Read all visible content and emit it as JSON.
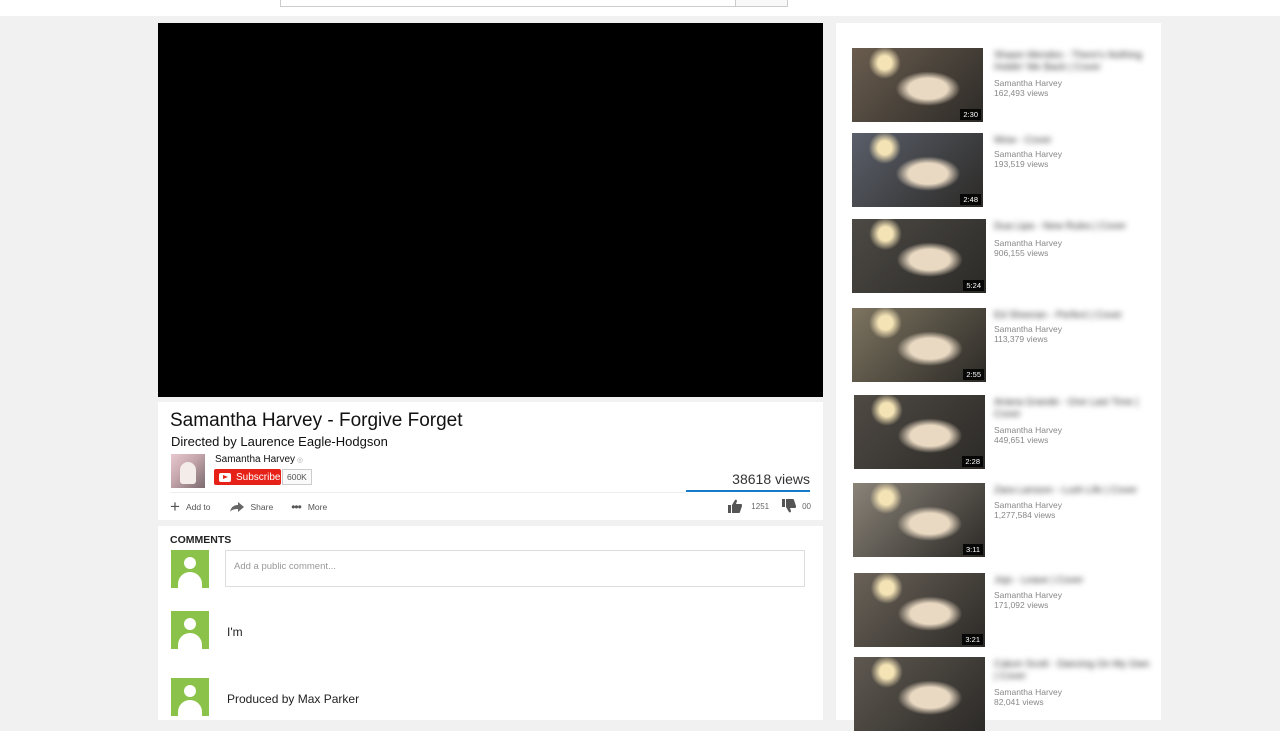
{
  "video": {
    "title": "Samantha Harvey - Forgive Forget",
    "subtitle": "Directed by Laurence Eagle-Hodgson",
    "channel": "Samantha Harvey",
    "subscribe_label": "Subscribe",
    "subscriber_count": "600K",
    "views": "38618 views",
    "like_ratio": 1.0,
    "likes": "1251",
    "dislikes": "00"
  },
  "actions": {
    "add_to": "Add to",
    "share": "Share",
    "more": "More"
  },
  "comments": {
    "heading": "COMMENTS",
    "placeholder": "Add a public comment...",
    "items": [
      {
        "text": "I'm"
      },
      {
        "text": "Produced by Max Parker"
      }
    ]
  },
  "recommendations": [
    {
      "title": "Shawn Mendes - There's Nothing Holdin' Me Back | Cover",
      "channel": "Samantha Harvey",
      "views": "162,493 views",
      "duration": "2:30",
      "thumb_color": "#6a5d4f"
    },
    {
      "title": "Wow - Cover",
      "channel": "Samantha Harvey",
      "views": "193,519 views",
      "duration": "2:48",
      "thumb_color": "#5a5f6a"
    },
    {
      "title": "Dua Lipa - New Rules | Cover",
      "channel": "Samantha Harvey",
      "views": "906,155 views",
      "duration": "5:24",
      "thumb_color": "#4d4a45"
    },
    {
      "title": "Ed Sheeran - Perfect | Cover",
      "channel": "Samantha Harvey",
      "views": "113,379 views",
      "duration": "2:55",
      "thumb_color": "#7d7460"
    },
    {
      "title": "Ariana Grande - One Last Time | Cover",
      "channel": "Samantha Harvey",
      "views": "449,651 views",
      "duration": "2:28",
      "thumb_color": "#4f4a44"
    },
    {
      "title": "Zara Larsson - Lush Life | Cover",
      "channel": "Samantha Harvey",
      "views": "1,277,584 views",
      "duration": "3:11",
      "thumb_color": "#8a8378"
    },
    {
      "title": "Jojo - Leave | Cover",
      "channel": "Samantha Harvey",
      "views": "171,092 views",
      "duration": "3:21",
      "thumb_color": "#6a6258"
    },
    {
      "title": "Calum Scott - Dancing On My Own | Cover",
      "channel": "Samantha Harvey",
      "views": "82,041 views",
      "duration": "",
      "thumb_color": "#5e5850"
    }
  ]
}
